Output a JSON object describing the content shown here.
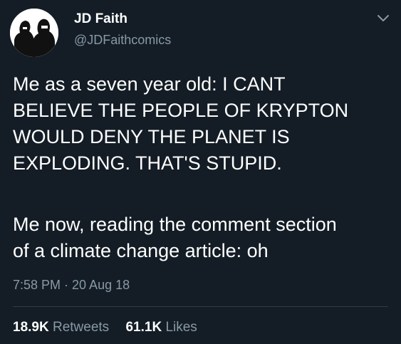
{
  "author": {
    "name": "JD Faith",
    "handle": "@JDFaithcomics",
    "avatar_icon": "avatar-image"
  },
  "menu_icon": "chevron-down-icon",
  "tweet": {
    "paragraphs": [
      "Me as a seven year old: I CANT\nBELIEVE THE PEOPLE OF KRYPTON\nWOULD DENY THE PLANET IS\nEXPLODING. THAT'S STUPID.",
      "Me now, reading the comment section\nof a climate change article: oh"
    ],
    "timestamp": "7:58 PM · 20 Aug 18"
  },
  "stats": {
    "retweets_count": "18.9K",
    "retweets_label": "Retweets",
    "likes_count": "61.1K",
    "likes_label": "Likes"
  },
  "colors": {
    "background": "#141d26",
    "text": "#ffffff",
    "muted": "#8899a6",
    "divider": "#2f3b47"
  }
}
